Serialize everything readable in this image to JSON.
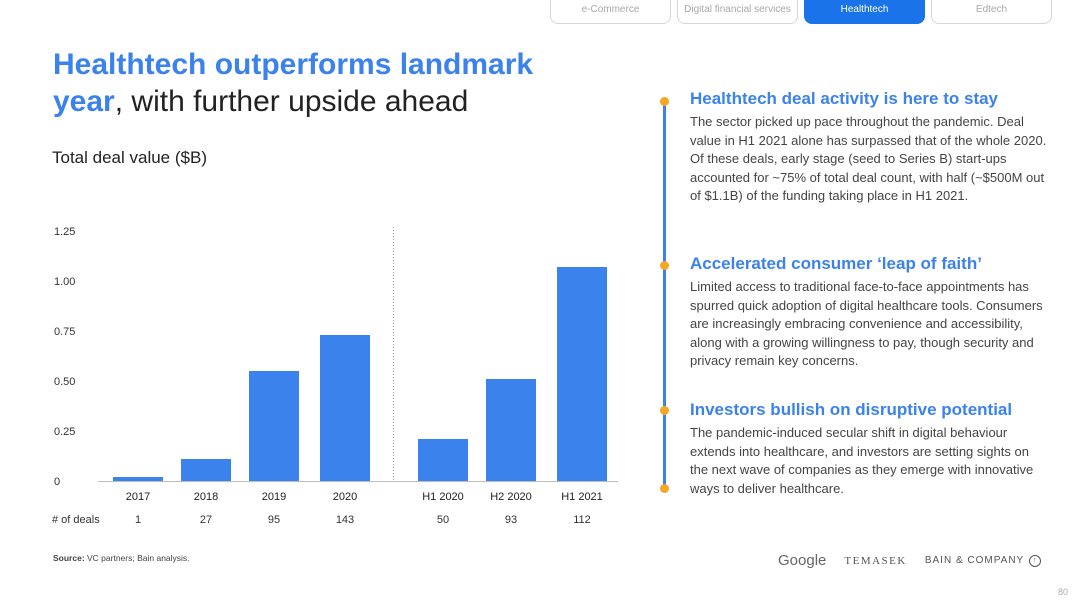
{
  "tabs": [
    "e-Commerce",
    "Digital financial services",
    "Healthtech",
    "Edtech"
  ],
  "active_tab": "Healthtech",
  "title": {
    "highlight_line1": "Healthtech outperforms landmark",
    "highlight_line2": "year",
    "rest": ", with further upside ahead"
  },
  "chart_title": "Total deal value ($B)",
  "chart_data": {
    "type": "bar",
    "categories": [
      "2017",
      "2018",
      "2019",
      "2020",
      "H1 2020",
      "H2 2020",
      "H1 2021"
    ],
    "values": [
      0.02,
      0.11,
      0.55,
      0.73,
      0.21,
      0.51,
      1.07
    ],
    "ylim": [
      0,
      1.25
    ],
    "yticks": [
      "0",
      "0.25",
      "0.50",
      "0.75",
      "1.00",
      "1.25"
    ],
    "ytick_values": [
      0,
      0.25,
      0.5,
      0.75,
      1.0,
      1.25
    ],
    "deals_label": "# of deals",
    "deals": [
      "1",
      "27",
      "95",
      "143",
      "50",
      "93",
      "112"
    ],
    "bar_color": "#3b82ec",
    "grid": false,
    "xlabel": "",
    "ylabel": ""
  },
  "source": {
    "label": "Source:",
    "text": " VC partners; Bain analysis."
  },
  "sections": [
    {
      "heading": "Healthtech deal activity is here to stay",
      "body": "The sector picked up pace throughout the pandemic. Deal value in H1 2021 alone has surpassed that of the whole 2020. Of these deals, early stage (seed to Series B) start-ups accounted for ~75% of total deal count, with half (~$500M out of $1.1B) of the funding taking place in H1 2021."
    },
    {
      "heading": "Accelerated consumer ‘leap of faith’",
      "body": "Limited access to traditional face-to-face appointments has spurred quick adoption of digital healthcare tools. Consumers are increasingly embracing convenience and accessibility, along with a growing willingness to pay, though security and privacy remain key concerns."
    },
    {
      "heading": "Investors bullish on disruptive potential",
      "body": "The pandemic-induced secular shift in digital behaviour extends into healthcare, and investors are setting sights on the next wave of companies as they emerge with innovative ways to deliver healthcare."
    }
  ],
  "logos": {
    "google": "Google",
    "temasek": "TEMASEK",
    "bain": "BAIN & COMPANY"
  },
  "page_number": "80",
  "colors": {
    "accent": "#3b82ec",
    "timeline_dot": "#f5a623",
    "active_tab": "#1a73e8"
  }
}
